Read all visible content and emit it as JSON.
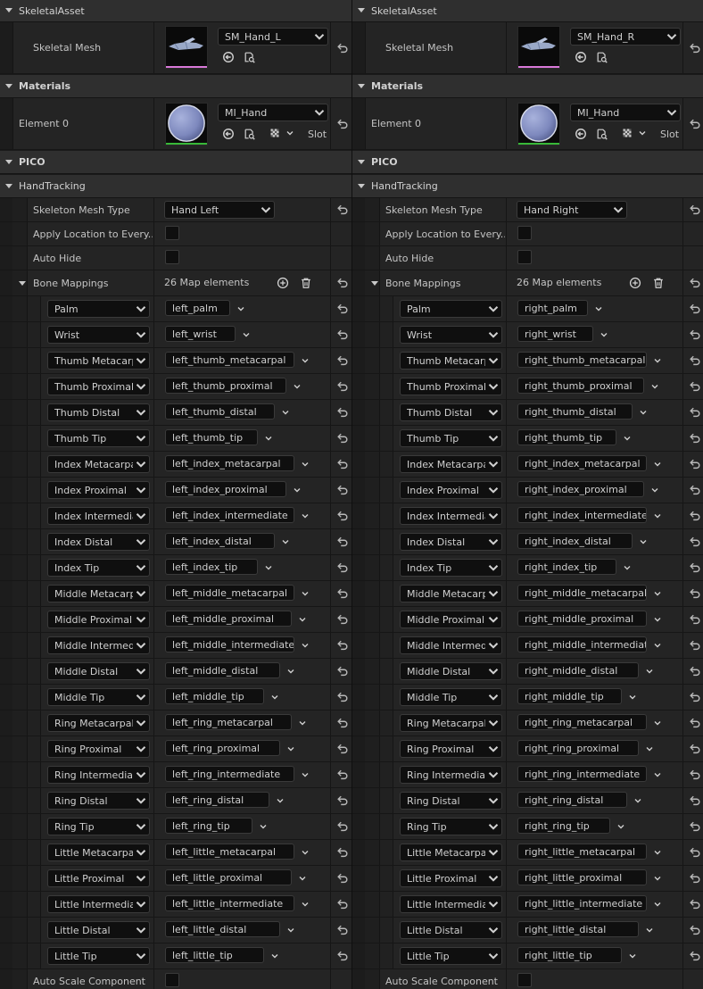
{
  "colors": {
    "mesh_bar": "#d878d8",
    "material_bar": "#38b838",
    "accent_text": "#c4c4c4"
  },
  "icons": {
    "reset": "reset-arrow-icon",
    "browse": "browse-asset-icon",
    "find": "find-in-folder-icon",
    "add": "add-element-icon",
    "delete": "delete-icon",
    "dropdown": "chevron-down-icon",
    "checker": "checker-texture-icon"
  },
  "panels": [
    {
      "side": "left",
      "categories": {
        "skeletal_asset": "SkeletalAsset",
        "materials": "Materials",
        "pico": "PICO",
        "hand_tracking": "HandTracking"
      },
      "skeletal_mesh": {
        "label": "Skeletal Mesh",
        "value": "SM_Hand_L"
      },
      "element0": {
        "label": "Element 0",
        "value": "MI_Hand",
        "slot": "Slot"
      },
      "skeleton_mesh_type": {
        "label": "Skeleton Mesh Type",
        "value": "Hand Left"
      },
      "apply_location": {
        "label": "Apply Location to Every..."
      },
      "auto_hide": {
        "label": "Auto Hide"
      },
      "bone_mappings": {
        "label": "Bone Mappings",
        "count": "26 Map elements"
      },
      "mappings": [
        {
          "key": "Palm",
          "value": "left_palm"
        },
        {
          "key": "Wrist",
          "value": "left_wrist"
        },
        {
          "key": "Thumb Metacarpal",
          "value": "left_thumb_metacarpal"
        },
        {
          "key": "Thumb Proximal",
          "value": "left_thumb_proximal"
        },
        {
          "key": "Thumb Distal",
          "value": "left_thumb_distal"
        },
        {
          "key": "Thumb Tip",
          "value": "left_thumb_tip"
        },
        {
          "key": "Index Metacarpal",
          "value": "left_index_metacarpal"
        },
        {
          "key": "Index Proximal",
          "value": "left_index_proximal"
        },
        {
          "key": "Index Intermediate",
          "value": "left_index_intermediate"
        },
        {
          "key": "Index Distal",
          "value": "left_index_distal"
        },
        {
          "key": "Index Tip",
          "value": "left_index_tip"
        },
        {
          "key": "Middle Metacarpal",
          "value": "left_middle_metacarpal"
        },
        {
          "key": "Middle Proximal",
          "value": "left_middle_proximal"
        },
        {
          "key": "Middle Intermediate",
          "value": "left_middle_intermediate"
        },
        {
          "key": "Middle Distal",
          "value": "left_middle_distal"
        },
        {
          "key": "Middle Tip",
          "value": "left_middle_tip"
        },
        {
          "key": "Ring Metacarpal",
          "value": "left_ring_metacarpal"
        },
        {
          "key": "Ring Proximal",
          "value": "left_ring_proximal"
        },
        {
          "key": "Ring Intermediate",
          "value": "left_ring_intermediate"
        },
        {
          "key": "Ring Distal",
          "value": "left_ring_distal"
        },
        {
          "key": "Ring Tip",
          "value": "left_ring_tip"
        },
        {
          "key": "Little Metacarpal",
          "value": "left_little_metacarpal"
        },
        {
          "key": "Little Proximal",
          "value": "left_little_proximal"
        },
        {
          "key": "Little Intermediate",
          "value": "left_little_intermediate"
        },
        {
          "key": "Little Distal",
          "value": "left_little_distal"
        },
        {
          "key": "Little Tip",
          "value": "left_little_tip"
        }
      ],
      "auto_scale": {
        "label": "Auto Scale Component"
      }
    },
    {
      "side": "right",
      "categories": {
        "skeletal_asset": "SkeletalAsset",
        "materials": "Materials",
        "pico": "PICO",
        "hand_tracking": "HandTracking"
      },
      "skeletal_mesh": {
        "label": "Skeletal Mesh",
        "value": "SM_Hand_R"
      },
      "element0": {
        "label": "Element 0",
        "value": "MI_Hand",
        "slot": "Slot"
      },
      "skeleton_mesh_type": {
        "label": "Skeleton Mesh Type",
        "value": "Hand Right"
      },
      "apply_location": {
        "label": "Apply Location to Every..."
      },
      "auto_hide": {
        "label": "Auto Hide"
      },
      "bone_mappings": {
        "label": "Bone Mappings",
        "count": "26 Map elements"
      },
      "mappings": [
        {
          "key": "Palm",
          "value": "right_palm"
        },
        {
          "key": "Wrist",
          "value": "right_wrist"
        },
        {
          "key": "Thumb Metacarpal",
          "value": "right_thumb_metacarpal"
        },
        {
          "key": "Thumb Proximal",
          "value": "right_thumb_proximal"
        },
        {
          "key": "Thumb Distal",
          "value": "right_thumb_distal"
        },
        {
          "key": "Thumb Tip",
          "value": "right_thumb_tip"
        },
        {
          "key": "Index Metacarpal",
          "value": "right_index_metacarpal"
        },
        {
          "key": "Index Proximal",
          "value": "right_index_proximal"
        },
        {
          "key": "Index Intermediate",
          "value": "right_index_intermediate"
        },
        {
          "key": "Index Distal",
          "value": "right_index_distal"
        },
        {
          "key": "Index Tip",
          "value": "right_index_tip"
        },
        {
          "key": "Middle Metacarpal",
          "value": "right_middle_metacarpal"
        },
        {
          "key": "Middle Proximal",
          "value": "right_middle_proximal"
        },
        {
          "key": "Middle Intermediate",
          "value": "right_middle_intermediat"
        },
        {
          "key": "Middle Distal",
          "value": "right_middle_distal"
        },
        {
          "key": "Middle Tip",
          "value": "right_middle_tip"
        },
        {
          "key": "Ring Metacarpal",
          "value": "right_ring_metacarpal"
        },
        {
          "key": "Ring Proximal",
          "value": "right_ring_proximal"
        },
        {
          "key": "Ring Intermediate",
          "value": "right_ring_intermediate"
        },
        {
          "key": "Ring Distal",
          "value": "right_ring_distal"
        },
        {
          "key": "Ring Tip",
          "value": "right_ring_tip"
        },
        {
          "key": "Little Metacarpal",
          "value": "right_little_metacarpal"
        },
        {
          "key": "Little Proximal",
          "value": "right_little_proximal"
        },
        {
          "key": "Little Intermediate",
          "value": "right_little_intermediate"
        },
        {
          "key": "Little Distal",
          "value": "right_little_distal"
        },
        {
          "key": "Little Tip",
          "value": "right_little_tip"
        }
      ],
      "auto_scale": {
        "label": "Auto Scale Component"
      }
    }
  ]
}
